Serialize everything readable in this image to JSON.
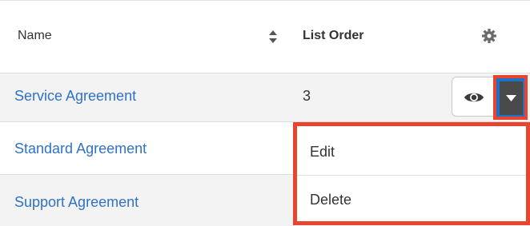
{
  "table": {
    "columns": [
      {
        "label": "Name"
      },
      {
        "label": "List Order"
      }
    ],
    "rows": [
      {
        "name": "Service Agreement",
        "list_order": "3"
      },
      {
        "name": "Standard Agreement",
        "list_order": ""
      },
      {
        "name": "Support Agreement",
        "list_order": ""
      }
    ]
  },
  "icons": {
    "sort": "sort-icon",
    "settings": "gear-icon",
    "preview": "eye-icon",
    "actions": "caret-down-icon"
  },
  "dropdown": {
    "items": [
      {
        "label": "Edit"
      },
      {
        "label": "Delete"
      }
    ]
  },
  "colors": {
    "link": "#2f72c6",
    "highlight": "#e8452e",
    "focus": "#1e73c8",
    "row_stripe": "#f3f3f3",
    "caret_button": "#4a4a4a"
  }
}
